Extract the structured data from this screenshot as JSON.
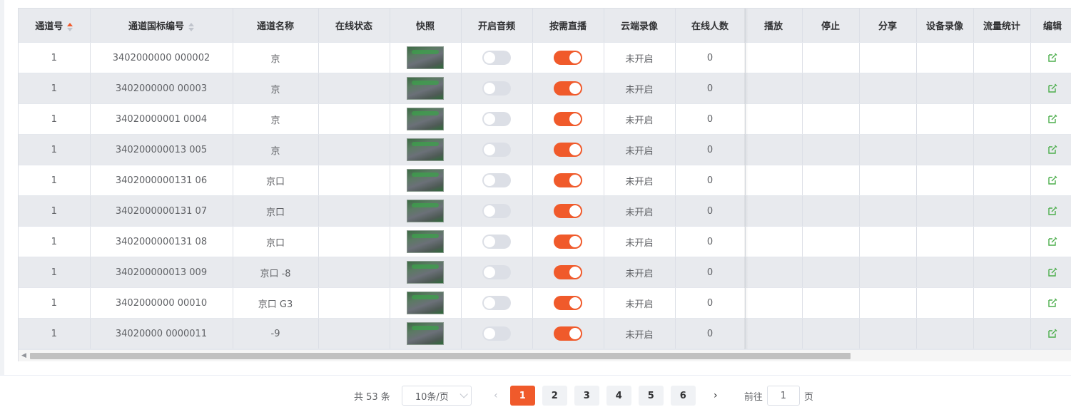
{
  "columns": {
    "channel_no": "通道号",
    "gb_id": "通道国标编号",
    "name": "通道名称",
    "online": "在线状态",
    "snapshot": "快照",
    "audio": "开启音频",
    "on_demand": "按需直播",
    "cloud_rec": "云端录像",
    "viewers": "在线人数",
    "play": "播放",
    "stop": "停止",
    "share": "分享",
    "device_rec": "设备录像",
    "traffic": "流量统计",
    "edit": "编辑"
  },
  "rows": [
    {
      "channel_no": "1",
      "gb_id": "3402000000  000002",
      "name": "京",
      "online": "",
      "audio": false,
      "on_demand": true,
      "cloud_rec": "未开启",
      "viewers": "0"
    },
    {
      "channel_no": "1",
      "gb_id": "3402000000  00003",
      "name": "京",
      "online": "",
      "audio": false,
      "on_demand": true,
      "cloud_rec": "未开启",
      "viewers": "0"
    },
    {
      "channel_no": "1",
      "gb_id": "34020000001  0004",
      "name": "京",
      "online": "",
      "audio": false,
      "on_demand": true,
      "cloud_rec": "未开启",
      "viewers": "0"
    },
    {
      "channel_no": "1",
      "gb_id": "340200000013  005",
      "name": "京",
      "online": "",
      "audio": false,
      "on_demand": true,
      "cloud_rec": "未开启",
      "viewers": "0"
    },
    {
      "channel_no": "1",
      "gb_id": "3402000000131  06",
      "name": "京口",
      "online": "",
      "audio": false,
      "on_demand": true,
      "cloud_rec": "未开启",
      "viewers": "0"
    },
    {
      "channel_no": "1",
      "gb_id": "3402000000131  07",
      "name": "京口",
      "online": "",
      "audio": false,
      "on_demand": true,
      "cloud_rec": "未开启",
      "viewers": "0"
    },
    {
      "channel_no": "1",
      "gb_id": "3402000000131  08",
      "name": "京口",
      "online": "",
      "audio": false,
      "on_demand": true,
      "cloud_rec": "未开启",
      "viewers": "0"
    },
    {
      "channel_no": "1",
      "gb_id": "340200000013  009",
      "name": "京口 -8",
      "online": "",
      "audio": false,
      "on_demand": true,
      "cloud_rec": "未开启",
      "viewers": "0"
    },
    {
      "channel_no": "1",
      "gb_id": "3402000000  00010",
      "name": "京口 G3",
      "online": "",
      "audio": false,
      "on_demand": true,
      "cloud_rec": "未开启",
      "viewers": "0"
    },
    {
      "channel_no": "1",
      "gb_id": "34020000  0000011",
      "name": "-9",
      "online": "",
      "audio": false,
      "on_demand": true,
      "cloud_rec": "未开启",
      "viewers": "0"
    }
  ],
  "pagination": {
    "total_label": "共 53 条",
    "page_size": "10条/页",
    "pages": [
      "1",
      "2",
      "3",
      "4",
      "5",
      "6"
    ],
    "current": "1",
    "goto_label": "前往",
    "goto_value": "1",
    "page_unit": "页",
    "prev_icon": "‹",
    "next_icon": "›"
  },
  "colors": {
    "accent": "#f05a2b",
    "edit_icon": "#4cae4c",
    "header_bg": "#e8eaee"
  },
  "icons": {
    "edit": "edit-icon",
    "sort": "sort-caret-icon"
  }
}
